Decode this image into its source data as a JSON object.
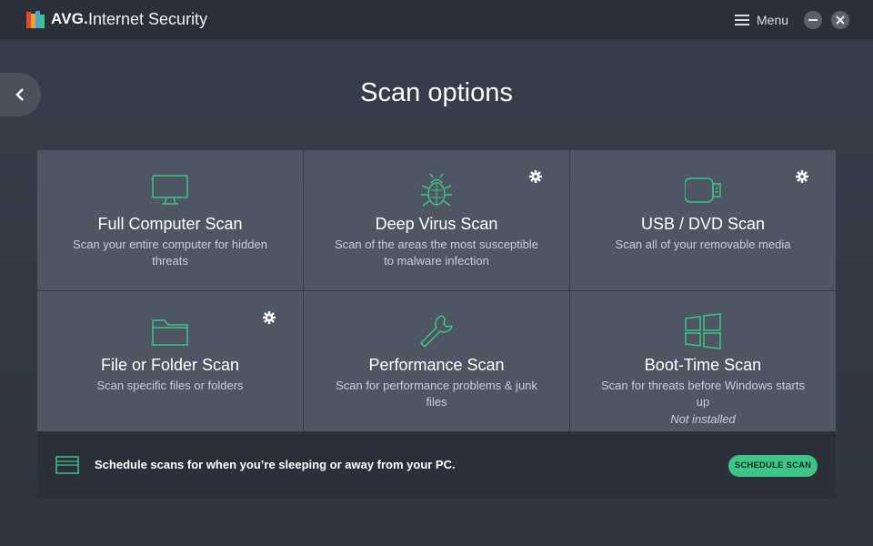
{
  "app": {
    "brand": "AVG.",
    "product": "Internet Security",
    "menu_label": "Menu"
  },
  "page": {
    "title": "Scan options"
  },
  "tiles": [
    {
      "title": "Full Computer Scan",
      "desc": "Scan your entire computer for hidden threats",
      "icon": "monitor-icon",
      "has_settings": false,
      "note": ""
    },
    {
      "title": "Deep Virus Scan",
      "desc": "Scan of the areas the most susceptible to malware infection",
      "icon": "bug-icon",
      "has_settings": true,
      "note": ""
    },
    {
      "title": "USB / DVD Scan",
      "desc": "Scan all of your removable media",
      "icon": "usb-drive-icon",
      "has_settings": true,
      "note": ""
    },
    {
      "title": "File or Folder Scan",
      "desc": "Scan specific files or folders",
      "icon": "folder-icon",
      "has_settings": true,
      "note": ""
    },
    {
      "title": "Performance Scan",
      "desc": "Scan for performance problems & junk files",
      "icon": "wrench-icon",
      "has_settings": false,
      "note": ""
    },
    {
      "title": "Boot-Time Scan",
      "desc": "Scan for threats before Windows starts up",
      "icon": "windows-icon",
      "has_settings": false,
      "note": "Not installed"
    }
  ],
  "schedule": {
    "text": "Schedule scans for when you’re sleeping or away from your PC.",
    "button_label": "SCHEDULE SCAN",
    "icon": "calendar-icon"
  },
  "colors": {
    "accent": "#3ec487",
    "tile_bg": "#4e5664",
    "background": "#363c48",
    "bar_bg": "#2b2f39"
  }
}
